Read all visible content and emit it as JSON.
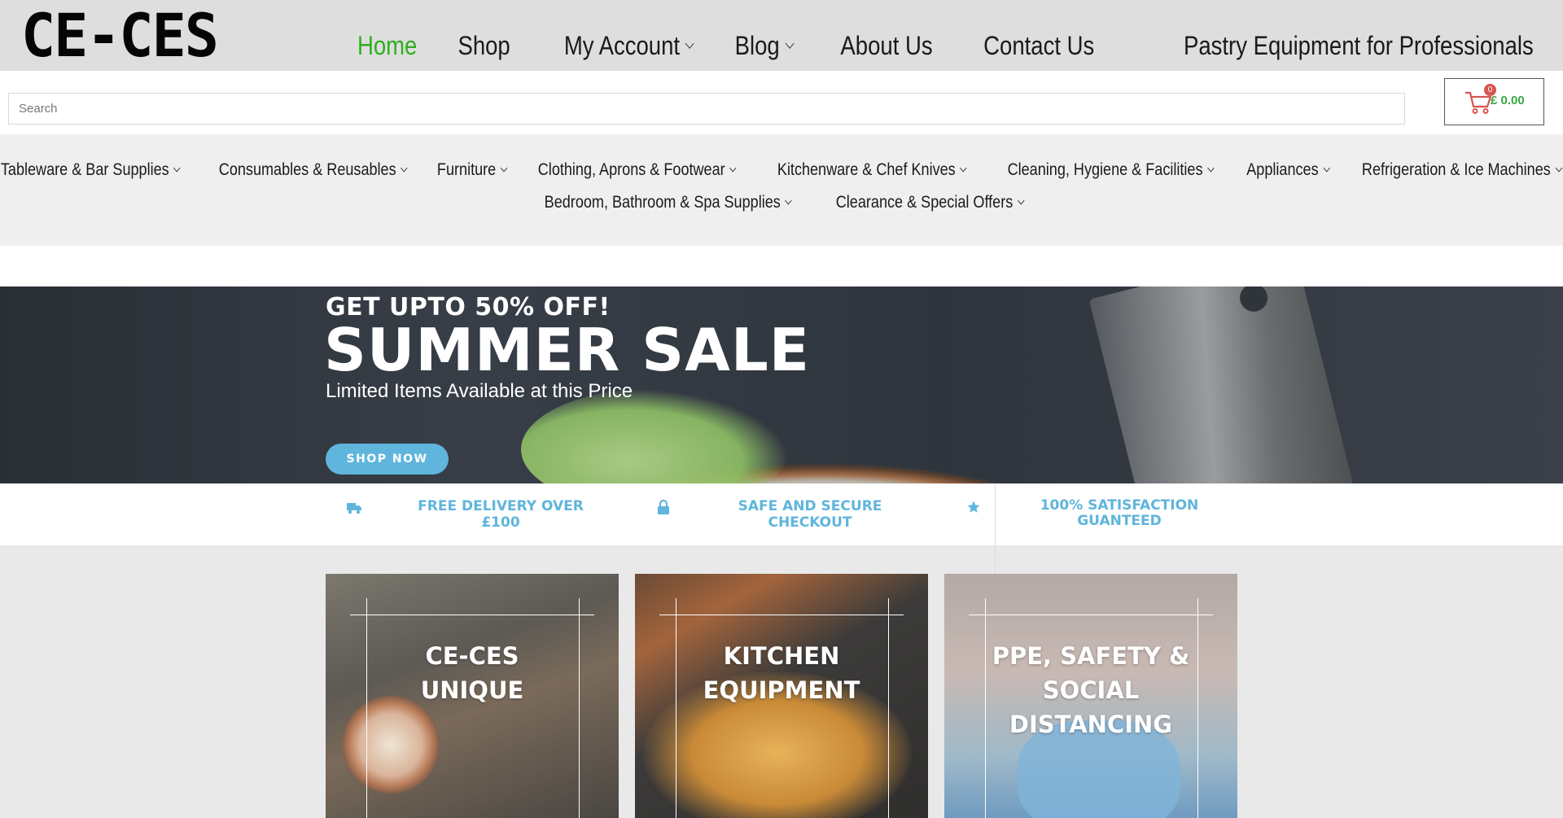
{
  "brand": {
    "logo_text": "CE-CES"
  },
  "main_nav": [
    {
      "label": "Home",
      "active": true,
      "dropdown": false
    },
    {
      "label": "Shop",
      "active": false,
      "dropdown": false
    },
    {
      "label": "My Account",
      "active": false,
      "dropdown": true
    },
    {
      "label": "Blog",
      "active": false,
      "dropdown": true
    },
    {
      "label": "About Us",
      "active": false,
      "dropdown": false
    },
    {
      "label": "Contact Us",
      "active": false,
      "dropdown": false
    },
    {
      "label": "Pastry Equipment for Professionals",
      "active": false,
      "dropdown": false
    }
  ],
  "search": {
    "placeholder": "Search",
    "value": ""
  },
  "cart": {
    "icon": "cart-icon",
    "count": "0",
    "total": "£ 0.00"
  },
  "categories_row1": [
    "Tableware & Bar Supplies",
    "Consumables & Reusables",
    "Furniture",
    "Clothing, Aprons & Footwear",
    "Kitchenware & Chef Knives",
    "Cleaning, Hygiene & Facilities",
    "Appliances",
    "Refrigeration & Ice Machines"
  ],
  "categories_row2": [
    "Bedroom, Bathroom & Spa Supplies",
    "Clearance & Special Offers"
  ],
  "hero": {
    "pre_title": "GET UPTO 50% OFF!",
    "title": "SUMMER SALE",
    "subtitle": "Limited Items Available at this Price",
    "button": "SHOP NOW"
  },
  "features": [
    {
      "icon": "truck-icon",
      "text": "FREE DELIVERY OVER £100"
    },
    {
      "icon": "lock-icon",
      "text": "SAFE AND SECURE CHECKOUT"
    },
    {
      "icon": "star-icon",
      "text": "100% SATISFACTION GUANTEED"
    }
  ],
  "tiles": [
    {
      "label": "CE-CES UNIQUE"
    },
    {
      "label": "KITCHEN EQUIPMENT"
    },
    {
      "label": "PPE, SAFETY & SOCIAL DISTANCING"
    }
  ],
  "colors": {
    "accent": "#5fb5dc",
    "active_nav": "#2fae1f",
    "cart_total": "#3aa644",
    "badge": "#d9534f"
  }
}
